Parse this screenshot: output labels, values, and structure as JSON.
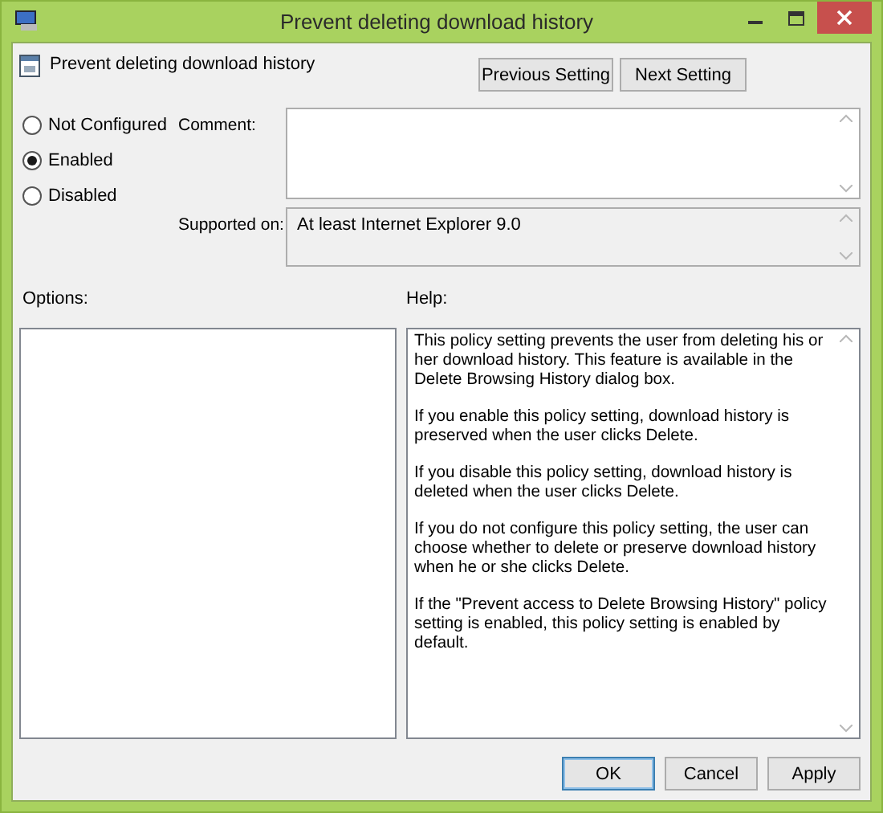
{
  "window": {
    "title": "Prevent deleting download history"
  },
  "policy": {
    "name": "Prevent deleting download history"
  },
  "nav_buttons": [
    "Previous Setting",
    "Next Setting"
  ],
  "options": [
    {
      "label": "Not Configured",
      "selected": false
    },
    {
      "label": "Enabled",
      "selected": true
    },
    {
      "label": "Disabled",
      "selected": false
    }
  ],
  "comment": {
    "label": "Comment:"
  },
  "supported_on": {
    "label": "Supported on:",
    "value": "At least Internet Explorer 9.0"
  },
  "options_panel": {
    "label": "Options:"
  },
  "help": {
    "label": "Help:",
    "paragraphs": [
      "This policy setting prevents the user from deleting his or her download history. This feature is available in the Delete Browsing History dialog box.",
      "If you enable this policy setting, download history is preserved when the user clicks Delete.",
      "If you disable this policy setting, download history is deleted when the user clicks Delete.",
      "If you do not configure this policy setting, the user can choose whether to delete or preserve download history when he or she clicks Delete.",
      "If the \"Prevent access to Delete Browsing History\" policy setting is enabled, this policy setting is enabled by default."
    ]
  },
  "buttons": [
    {
      "label": "OK",
      "default": true
    },
    {
      "label": "Cancel",
      "default": false
    },
    {
      "label": "Apply",
      "default": false
    }
  ]
}
